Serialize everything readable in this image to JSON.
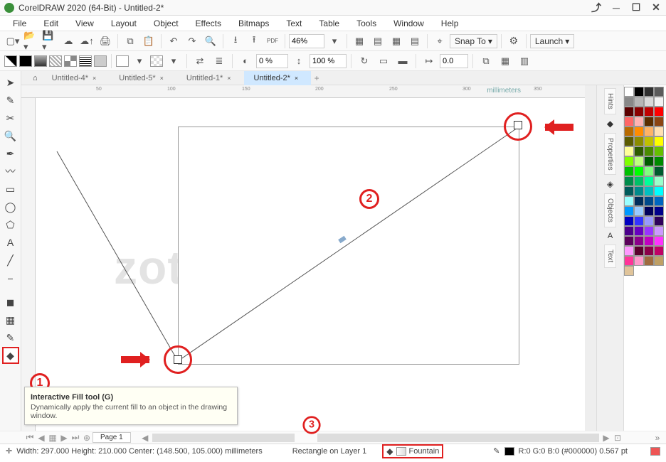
{
  "title": "CorelDRAW 2020 (64-Bit) - Untitled-2*",
  "menus": [
    "File",
    "Edit",
    "View",
    "Layout",
    "Object",
    "Effects",
    "Bitmaps",
    "Text",
    "Table",
    "Tools",
    "Window",
    "Help"
  ],
  "zoom": "46%",
  "toolbar_combo_snap": "Snap To",
  "toolbar_combo_launch": "Launch",
  "propbar": {
    "pct1": "0 %",
    "pct2": "100 %",
    "val": "0.0"
  },
  "tabs": [
    {
      "label": "Untitled-4*",
      "active": false
    },
    {
      "label": "Untitled-5*",
      "active": false
    },
    {
      "label": "Untitled-1*",
      "active": false
    },
    {
      "label": "Untitled-2*",
      "active": true
    }
  ],
  "ruler_unit": "millimeters",
  "ruler_ticks_h": [
    "50",
    "100",
    "150",
    "200",
    "250",
    "300",
    "350"
  ],
  "watermark": "zotutorial.com",
  "callouts": {
    "c1": "1",
    "c2": "2",
    "c3": "3"
  },
  "tooltip": {
    "title": "Interactive Fill tool (G)",
    "body": "Dynamically apply the current fill to an object in the drawing window."
  },
  "right_docks": [
    "Hints",
    "Properties",
    "Objects",
    "Text"
  ],
  "bottom_page_tab": "Page 1",
  "status": {
    "dims": "Width: 297.000  Height: 210.000  Center: (148.500, 105.000)  millimeters",
    "obj": "Rectangle on Layer 1",
    "fill": "Fountain",
    "stroke": "R:0 G:0 B:0 (#000000)  0.567 pt"
  },
  "palette": [
    "#ffffff",
    "#000000",
    "#2f2f2f",
    "#5b5b5b",
    "#888888",
    "#b6b6b6",
    "#d9d9d9",
    "#f2f2f2",
    "#5b0000",
    "#8b0000",
    "#c00000",
    "#ff0000",
    "#ff6666",
    "#ffb3b3",
    "#5b2e00",
    "#8b4513",
    "#b86a00",
    "#ff8c00",
    "#ffb366",
    "#ffe0b3",
    "#5b5b00",
    "#8b8b00",
    "#c0c000",
    "#ffff00",
    "#ffff99",
    "#2e5b00",
    "#4a8b00",
    "#66c000",
    "#80ff00",
    "#bfff80",
    "#005b00",
    "#008b00",
    "#00c000",
    "#00ff00",
    "#80ff80",
    "#005b2e",
    "#008b4a",
    "#00c066",
    "#00ff99",
    "#99ffcc",
    "#005b5b",
    "#008b8b",
    "#00c0c0",
    "#00ffff",
    "#99ffff",
    "#002e5b",
    "#004a8b",
    "#0066c0",
    "#0099ff",
    "#99ccff",
    "#00005b",
    "#00008b",
    "#0000c0",
    "#3333ff",
    "#9999ff",
    "#2e005b",
    "#4a008b",
    "#6600c0",
    "#9933ff",
    "#cc99ff",
    "#5b005b",
    "#8b008b",
    "#c000c0",
    "#ff33ff",
    "#ff99ff",
    "#5b002e",
    "#8b004a",
    "#c00066",
    "#ff3399",
    "#ff99cc",
    "#9f6b3f",
    "#bfa065",
    "#e0c49a"
  ]
}
